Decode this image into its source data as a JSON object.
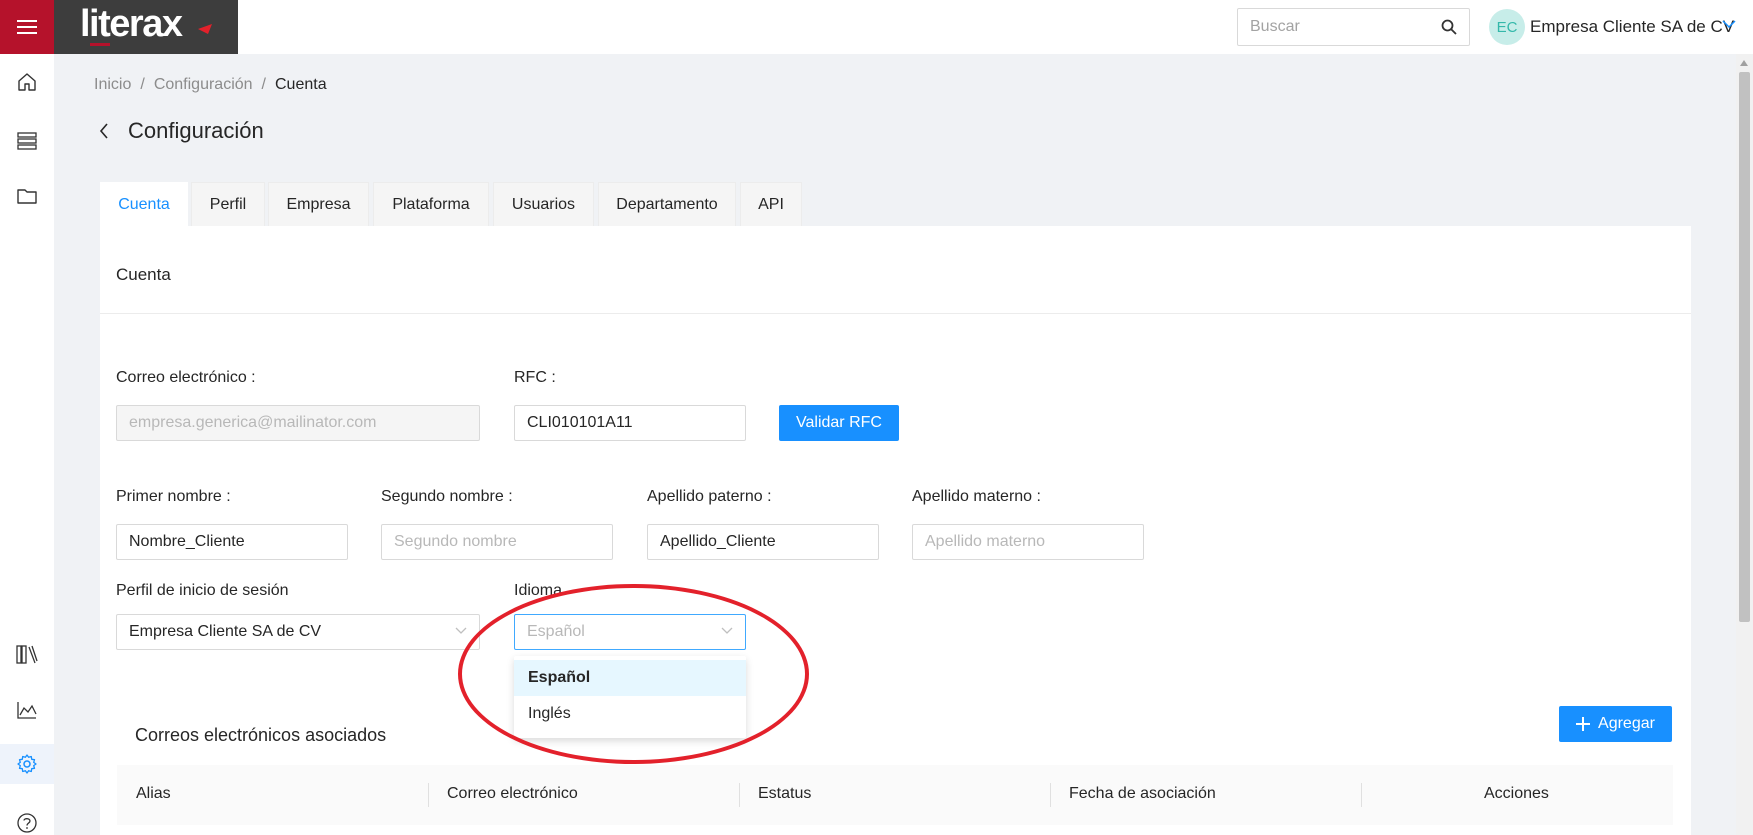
{
  "app": {
    "logo_text": "literax",
    "menu_icon": "hamburger-icon"
  },
  "topbar": {
    "search_placeholder": "Buscar",
    "avatar_initials": "EC",
    "company_name": "Empresa Cliente SA de CV"
  },
  "sidebar": {
    "items": [
      {
        "icon": "home-icon",
        "active": false
      },
      {
        "icon": "list-icon",
        "active": false
      },
      {
        "icon": "folder-icon",
        "active": false
      },
      {
        "icon": "library-icon",
        "active": false
      },
      {
        "icon": "chart-icon",
        "active": false
      },
      {
        "icon": "gear-icon",
        "active": true
      },
      {
        "icon": "help-icon",
        "active": false
      }
    ]
  },
  "breadcrumb": {
    "items": [
      "Inicio",
      "Configuración",
      "Cuenta"
    ]
  },
  "page": {
    "title": "Configuración"
  },
  "tabs": [
    {
      "label": "Cuenta",
      "active": true
    },
    {
      "label": "Perfil",
      "active": false
    },
    {
      "label": "Empresa",
      "active": false
    },
    {
      "label": "Plataforma",
      "active": false
    },
    {
      "label": "Usuarios",
      "active": false
    },
    {
      "label": "Departamento",
      "active": false
    },
    {
      "label": "API",
      "active": false
    }
  ],
  "card": {
    "title": "Cuenta"
  },
  "form": {
    "email": {
      "label": "Correo electrónico :",
      "value": "",
      "placeholder": "empresa.generica@mailinator.com"
    },
    "rfc": {
      "label": "RFC :",
      "value": "CLI010101A11"
    },
    "validate_button": "Validar RFC",
    "first_name": {
      "label": "Primer nombre :",
      "value": "Nombre_Cliente"
    },
    "second_name": {
      "label": "Segundo nombre :",
      "value": "",
      "placeholder": "Segundo nombre"
    },
    "paternal": {
      "label": "Apellido paterno :",
      "value": "Apellido_Cliente"
    },
    "maternal": {
      "label": "Apellido materno :",
      "value": "",
      "placeholder": "Apellido materno"
    },
    "login_profile": {
      "label": "Perfil de inicio de sesión",
      "value": "Empresa Cliente SA de CV"
    },
    "language": {
      "label": "Idioma",
      "value": "Español",
      "options": [
        "Español",
        "Inglés"
      ]
    }
  },
  "emails_section": {
    "title": "Correos electrónicos asociados",
    "add_button": "Agregar",
    "columns": [
      "Alias",
      "Correo electrónico",
      "Estatus",
      "Fecha de asociación",
      "Acciones"
    ]
  },
  "colors": {
    "brand_red": "#b5122b",
    "primary_blue": "#1890ff",
    "annotation_red": "#e3212b"
  }
}
